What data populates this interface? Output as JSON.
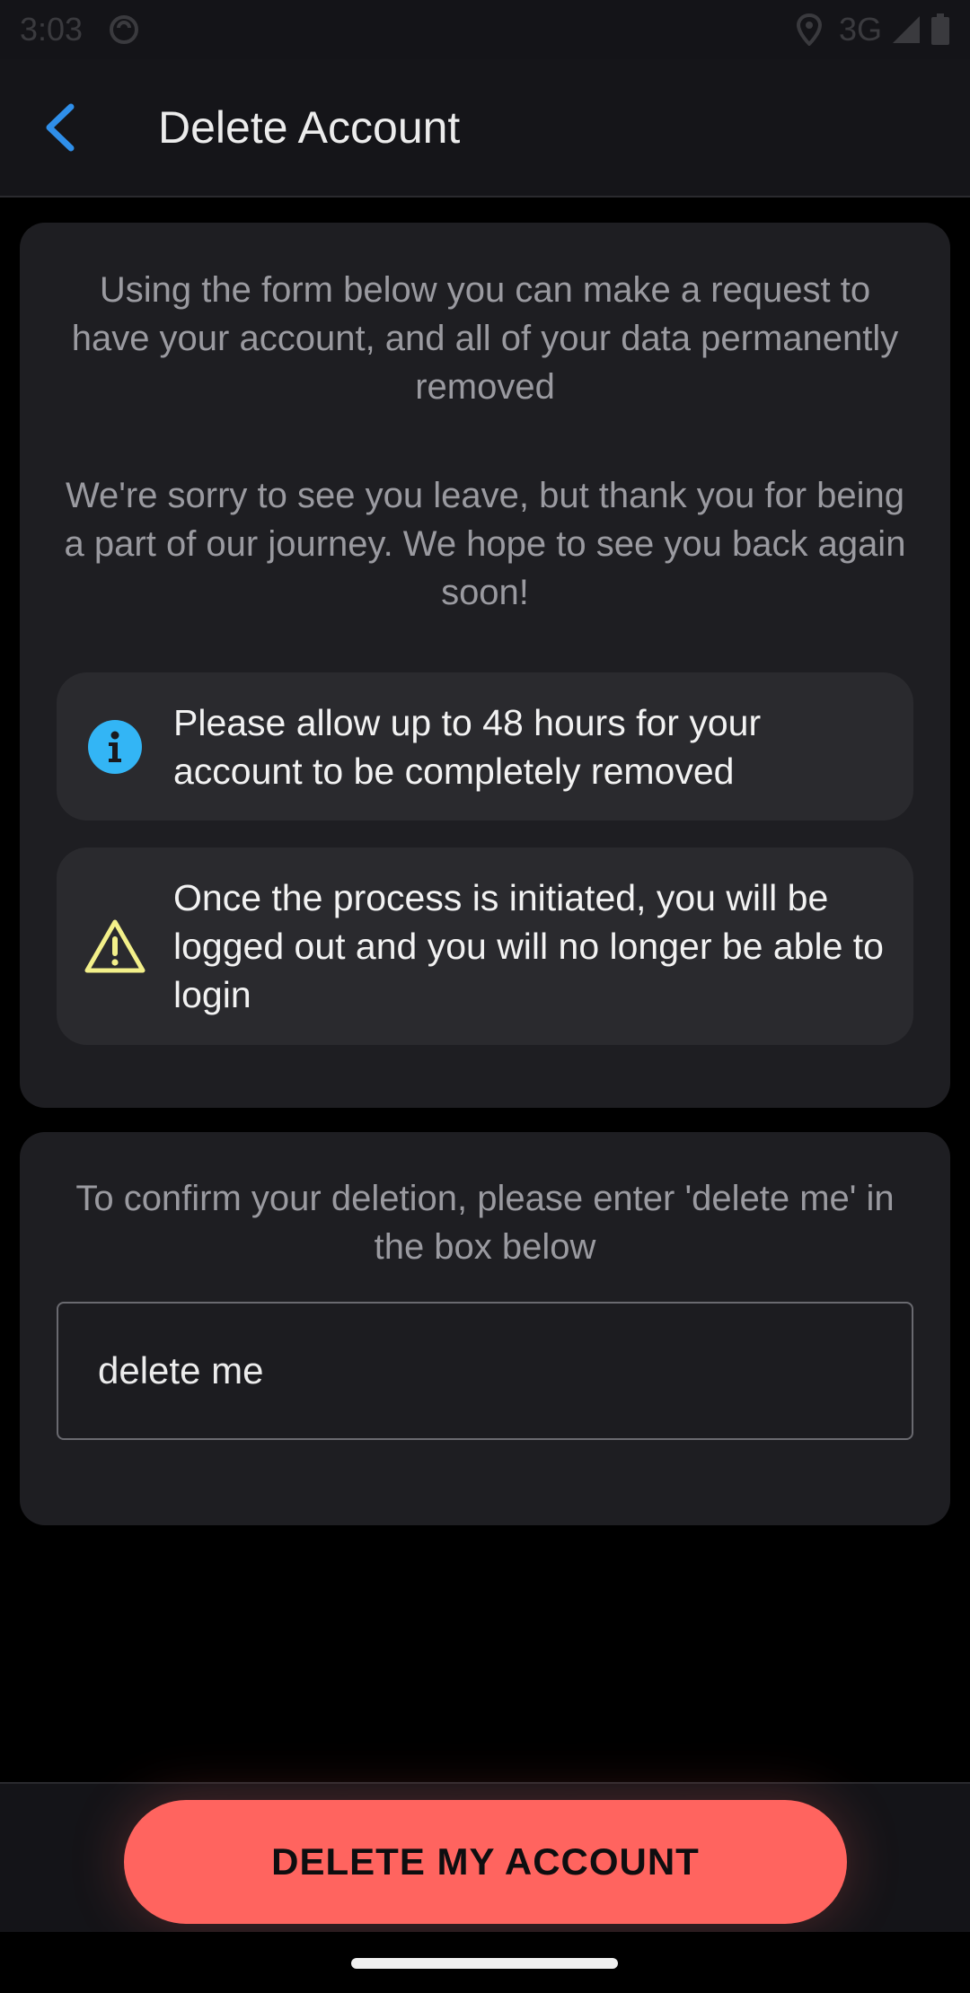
{
  "status_bar": {
    "time": "3:03",
    "network": "3G",
    "icons": [
      "app-notification-icon",
      "location-icon",
      "signal-icon",
      "battery-icon"
    ]
  },
  "app_bar": {
    "title": "Delete Account",
    "back_icon": "chevron-left-icon",
    "accent_color": "#2f8fea"
  },
  "info_card": {
    "paragraph_1": "Using the form below you can make a request to have your account, and all of your data permanently removed",
    "paragraph_2": "We're sorry to see you leave, but thank you for being a part of our journey. We hope to see you back again soon!",
    "notices": [
      {
        "icon": "info-icon",
        "text": "Please allow up to 48 hours for your account to be completely removed",
        "color": "#33b5f5"
      },
      {
        "icon": "warning-icon",
        "text": "Once the process is initiated, you will be logged out and you will no longer be able to login",
        "color": "#f3f08a"
      }
    ]
  },
  "confirm_card": {
    "instruction": "To confirm your deletion, please enter 'delete me' in the box below",
    "input_value": "delete me"
  },
  "footer": {
    "delete_button_label": "DELETE MY ACCOUNT",
    "button_color": "#ff645f"
  }
}
